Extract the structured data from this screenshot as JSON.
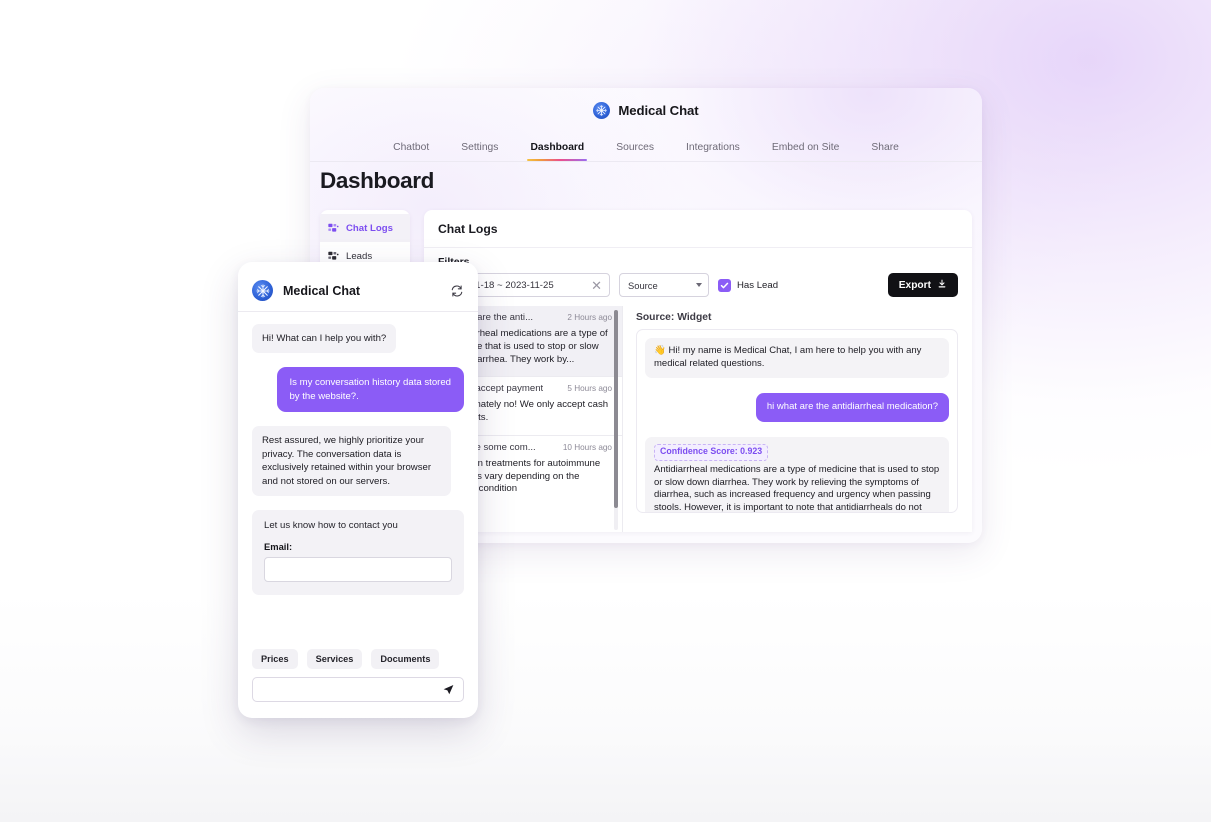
{
  "brand": {
    "name": "Medical Chat",
    "logo_icon": "snowflake-badge-icon"
  },
  "nav": {
    "tabs": [
      {
        "label": "Chatbot",
        "active": false
      },
      {
        "label": "Settings",
        "active": false
      },
      {
        "label": "Dashboard",
        "active": true
      },
      {
        "label": "Sources",
        "active": false
      },
      {
        "label": "Integrations",
        "active": false
      },
      {
        "label": "Embed on Site",
        "active": false
      },
      {
        "label": "Share",
        "active": false
      }
    ]
  },
  "page": {
    "title": "Dashboard"
  },
  "sidebar": {
    "items": [
      {
        "label": "Chat Logs",
        "icon": "chat-logs-icon",
        "active": true
      },
      {
        "label": "Leads",
        "icon": "leads-icon",
        "active": false
      }
    ]
  },
  "panel": {
    "heading": "Chat Logs",
    "filters_label": "Filters",
    "date_range": {
      "value": "2023-11-18 ~ 2023-11-25",
      "clear_icon": "close-icon"
    },
    "source_select": {
      "value": "Source",
      "caret_icon": "chevron-down-icon"
    },
    "has_lead": {
      "label": "Has Lead",
      "checked": true
    },
    "export": {
      "label": "Export",
      "icon": "download-icon"
    }
  },
  "log_list": [
    {
      "question": "hi what are the anti...",
      "time": "2 Hours ago",
      "answer": "Antidiarrheal medications are a type of medicine that is used to stop or slow down diarrhea. They work by...",
      "active": true
    },
    {
      "question": "do you accept payment",
      "time": "5 Hours ago",
      "answer": "Unfortunately no! We only accept cash payments.",
      "active": false
    },
    {
      "question": "what are some com...",
      "time": "10 Hours ago",
      "answer": "Common treatments for autoimmune diseases vary depending on the specific condition",
      "active": false
    }
  ],
  "detail": {
    "source_label": "Source: Widget",
    "messages": [
      {
        "role": "bot",
        "text": "👋 Hi! my name is Medical Chat, I am here to help you with any medical related questions."
      },
      {
        "role": "user",
        "text": "hi what are the antidiarrheal medication?"
      },
      {
        "role": "bot",
        "confidence_label": "Confidence Score: 0.923",
        "text": "Antidiarrheal medications are a type of medicine that is used to stop or slow down diarrhea. They work by relieving the symptoms of diarrhea, such as increased frequency and urgency when passing stools. However, it is important to note that antidiarrheals do not eliminate the underlying cause of diarrhea."
      }
    ]
  },
  "widget": {
    "title": "Medical Chat",
    "refresh_icon": "refresh-icon",
    "messages": [
      {
        "role": "bot",
        "text": "Hi! What can I help you with?"
      },
      {
        "role": "user",
        "text": "Is my conversation history data stored by the website?."
      },
      {
        "role": "bot",
        "text": "Rest assured, we highly prioritize your privacy. The conversation data is exclusively retained within your browser and not stored on our servers."
      }
    ],
    "lead_form": {
      "title": "Let us know how to contact you",
      "email_label": "Email:",
      "email_value": "",
      "email_placeholder": ""
    },
    "suggestions": [
      {
        "label": "Prices"
      },
      {
        "label": "Services"
      },
      {
        "label": "Documents"
      }
    ],
    "composer": {
      "value": "",
      "placeholder": "",
      "send_icon": "send-icon"
    }
  },
  "colors": {
    "accent_purple": "#8b5cf6",
    "brand_blue": "#2f63d8",
    "export_black": "#111115"
  }
}
